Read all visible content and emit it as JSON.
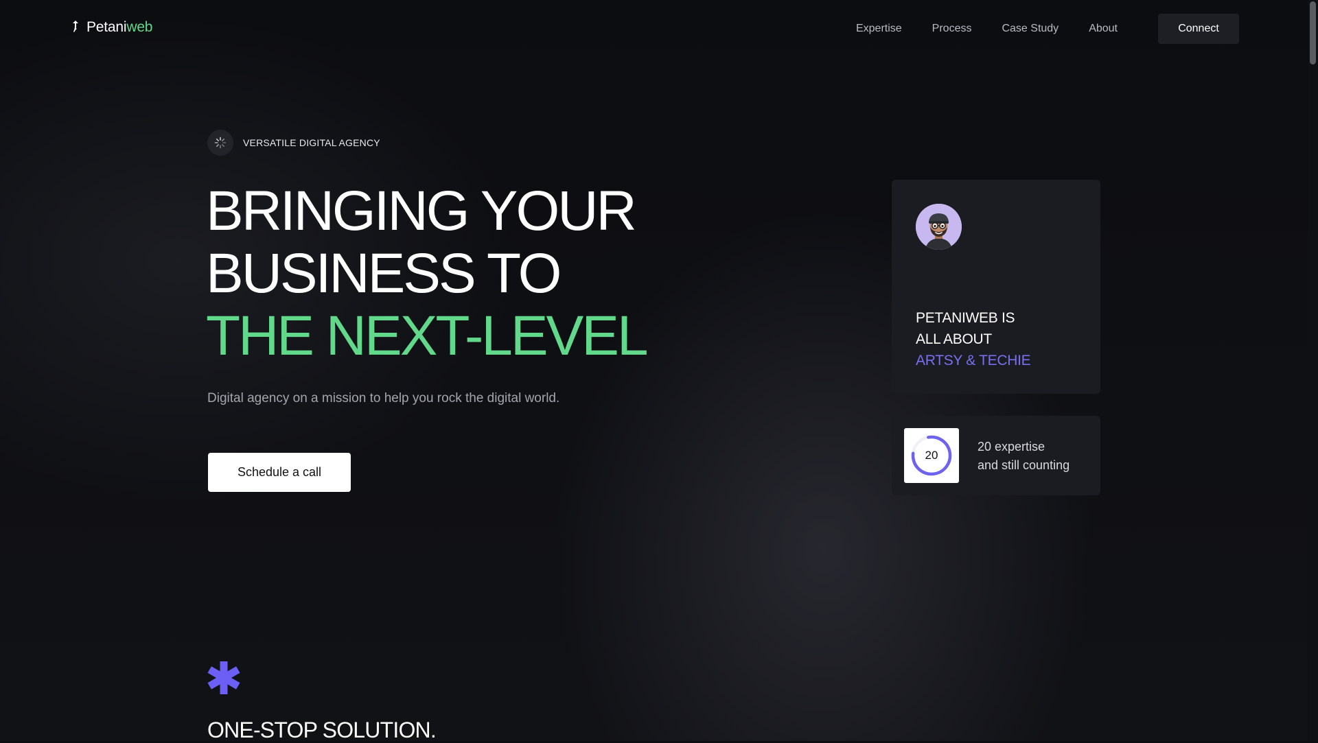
{
  "brand": {
    "name_part1": "Petani",
    "name_part2": "web"
  },
  "nav": {
    "links": [
      "Expertise",
      "Process",
      "Case Study",
      "About"
    ],
    "connect_label": "Connect"
  },
  "hero": {
    "tag": "VERSATILE DIGITAL AGENCY",
    "headline_line1": "BRINGING YOUR",
    "headline_line2": "BUSINESS TO",
    "headline_line3": "THE NEXT-LEVEL",
    "subtitle": "Digital agency on a mission to help you rock the digital world.",
    "cta_label": "Schedule a call"
  },
  "about_card": {
    "line1": "PETANIWEB IS",
    "line2": "ALL ABOUT",
    "line3": "ARTSY & TECHIE"
  },
  "stat_card": {
    "value": "20",
    "line1": "20 expertise",
    "line2": "and still counting"
  },
  "section": {
    "title": "ONE-STOP SOLUTION."
  },
  "colors": {
    "background": "#0d0e12",
    "accent_green": "#62d98a",
    "accent_purple": "#7a6ff0",
    "card": "#1b1c21"
  },
  "icons": [
    "logo-mark-icon",
    "sparkle-loader-icon",
    "avatar-memoji",
    "progress-ring-icon",
    "asterisk-icon"
  ]
}
